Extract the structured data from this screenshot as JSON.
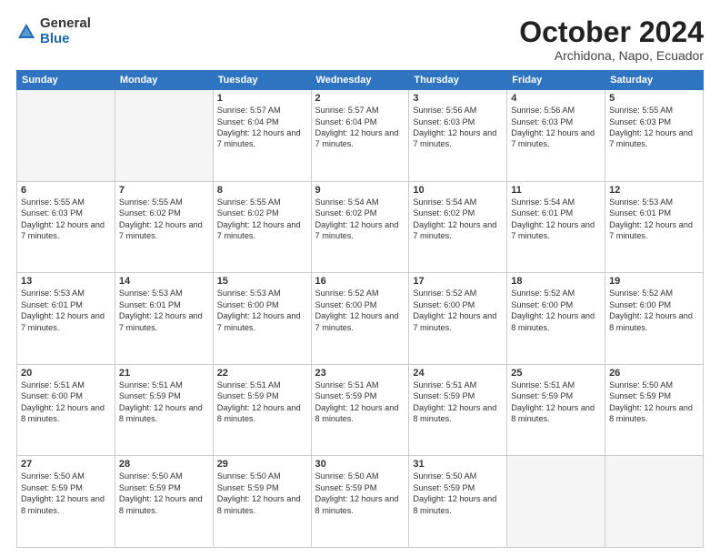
{
  "logo": {
    "general": "General",
    "blue": "Blue"
  },
  "header": {
    "month": "October 2024",
    "location": "Archidona, Napo, Ecuador"
  },
  "weekdays": [
    "Sunday",
    "Monday",
    "Tuesday",
    "Wednesday",
    "Thursday",
    "Friday",
    "Saturday"
  ],
  "weeks": [
    [
      {
        "day": "",
        "empty": true
      },
      {
        "day": "",
        "empty": true
      },
      {
        "day": "1",
        "sunrise": "Sunrise: 5:57 AM",
        "sunset": "Sunset: 6:04 PM",
        "daylight": "Daylight: 12 hours and 7 minutes."
      },
      {
        "day": "2",
        "sunrise": "Sunrise: 5:57 AM",
        "sunset": "Sunset: 6:04 PM",
        "daylight": "Daylight: 12 hours and 7 minutes."
      },
      {
        "day": "3",
        "sunrise": "Sunrise: 5:56 AM",
        "sunset": "Sunset: 6:03 PM",
        "daylight": "Daylight: 12 hours and 7 minutes."
      },
      {
        "day": "4",
        "sunrise": "Sunrise: 5:56 AM",
        "sunset": "Sunset: 6:03 PM",
        "daylight": "Daylight: 12 hours and 7 minutes."
      },
      {
        "day": "5",
        "sunrise": "Sunrise: 5:55 AM",
        "sunset": "Sunset: 6:03 PM",
        "daylight": "Daylight: 12 hours and 7 minutes."
      }
    ],
    [
      {
        "day": "6",
        "sunrise": "Sunrise: 5:55 AM",
        "sunset": "Sunset: 6:03 PM",
        "daylight": "Daylight: 12 hours and 7 minutes."
      },
      {
        "day": "7",
        "sunrise": "Sunrise: 5:55 AM",
        "sunset": "Sunset: 6:02 PM",
        "daylight": "Daylight: 12 hours and 7 minutes."
      },
      {
        "day": "8",
        "sunrise": "Sunrise: 5:55 AM",
        "sunset": "Sunset: 6:02 PM",
        "daylight": "Daylight: 12 hours and 7 minutes."
      },
      {
        "day": "9",
        "sunrise": "Sunrise: 5:54 AM",
        "sunset": "Sunset: 6:02 PM",
        "daylight": "Daylight: 12 hours and 7 minutes."
      },
      {
        "day": "10",
        "sunrise": "Sunrise: 5:54 AM",
        "sunset": "Sunset: 6:02 PM",
        "daylight": "Daylight: 12 hours and 7 minutes."
      },
      {
        "day": "11",
        "sunrise": "Sunrise: 5:54 AM",
        "sunset": "Sunset: 6:01 PM",
        "daylight": "Daylight: 12 hours and 7 minutes."
      },
      {
        "day": "12",
        "sunrise": "Sunrise: 5:53 AM",
        "sunset": "Sunset: 6:01 PM",
        "daylight": "Daylight: 12 hours and 7 minutes."
      }
    ],
    [
      {
        "day": "13",
        "sunrise": "Sunrise: 5:53 AM",
        "sunset": "Sunset: 6:01 PM",
        "daylight": "Daylight: 12 hours and 7 minutes."
      },
      {
        "day": "14",
        "sunrise": "Sunrise: 5:53 AM",
        "sunset": "Sunset: 6:01 PM",
        "daylight": "Daylight: 12 hours and 7 minutes."
      },
      {
        "day": "15",
        "sunrise": "Sunrise: 5:53 AM",
        "sunset": "Sunset: 6:00 PM",
        "daylight": "Daylight: 12 hours and 7 minutes."
      },
      {
        "day": "16",
        "sunrise": "Sunrise: 5:52 AM",
        "sunset": "Sunset: 6:00 PM",
        "daylight": "Daylight: 12 hours and 7 minutes."
      },
      {
        "day": "17",
        "sunrise": "Sunrise: 5:52 AM",
        "sunset": "Sunset: 6:00 PM",
        "daylight": "Daylight: 12 hours and 7 minutes."
      },
      {
        "day": "18",
        "sunrise": "Sunrise: 5:52 AM",
        "sunset": "Sunset: 6:00 PM",
        "daylight": "Daylight: 12 hours and 8 minutes."
      },
      {
        "day": "19",
        "sunrise": "Sunrise: 5:52 AM",
        "sunset": "Sunset: 6:00 PM",
        "daylight": "Daylight: 12 hours and 8 minutes."
      }
    ],
    [
      {
        "day": "20",
        "sunrise": "Sunrise: 5:51 AM",
        "sunset": "Sunset: 6:00 PM",
        "daylight": "Daylight: 12 hours and 8 minutes."
      },
      {
        "day": "21",
        "sunrise": "Sunrise: 5:51 AM",
        "sunset": "Sunset: 5:59 PM",
        "daylight": "Daylight: 12 hours and 8 minutes."
      },
      {
        "day": "22",
        "sunrise": "Sunrise: 5:51 AM",
        "sunset": "Sunset: 5:59 PM",
        "daylight": "Daylight: 12 hours and 8 minutes."
      },
      {
        "day": "23",
        "sunrise": "Sunrise: 5:51 AM",
        "sunset": "Sunset: 5:59 PM",
        "daylight": "Daylight: 12 hours and 8 minutes."
      },
      {
        "day": "24",
        "sunrise": "Sunrise: 5:51 AM",
        "sunset": "Sunset: 5:59 PM",
        "daylight": "Daylight: 12 hours and 8 minutes."
      },
      {
        "day": "25",
        "sunrise": "Sunrise: 5:51 AM",
        "sunset": "Sunset: 5:59 PM",
        "daylight": "Daylight: 12 hours and 8 minutes."
      },
      {
        "day": "26",
        "sunrise": "Sunrise: 5:50 AM",
        "sunset": "Sunset: 5:59 PM",
        "daylight": "Daylight: 12 hours and 8 minutes."
      }
    ],
    [
      {
        "day": "27",
        "sunrise": "Sunrise: 5:50 AM",
        "sunset": "Sunset: 5:59 PM",
        "daylight": "Daylight: 12 hours and 8 minutes."
      },
      {
        "day": "28",
        "sunrise": "Sunrise: 5:50 AM",
        "sunset": "Sunset: 5:59 PM",
        "daylight": "Daylight: 12 hours and 8 minutes."
      },
      {
        "day": "29",
        "sunrise": "Sunrise: 5:50 AM",
        "sunset": "Sunset: 5:59 PM",
        "daylight": "Daylight: 12 hours and 8 minutes."
      },
      {
        "day": "30",
        "sunrise": "Sunrise: 5:50 AM",
        "sunset": "Sunset: 5:59 PM",
        "daylight": "Daylight: 12 hours and 8 minutes."
      },
      {
        "day": "31",
        "sunrise": "Sunrise: 5:50 AM",
        "sunset": "Sunset: 5:59 PM",
        "daylight": "Daylight: 12 hours and 8 minutes."
      },
      {
        "day": "",
        "empty": true
      },
      {
        "day": "",
        "empty": true
      }
    ]
  ]
}
